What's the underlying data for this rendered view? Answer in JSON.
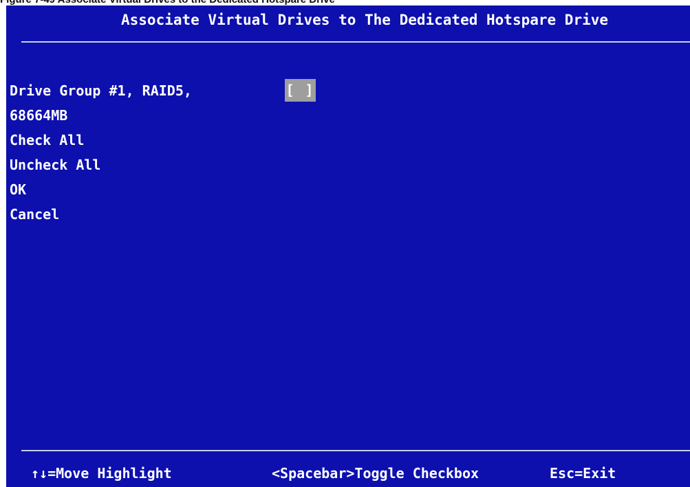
{
  "figure_caption": "Figure 7-49 Associate Virtual Drives to the Dedicated Hotspare Drive",
  "screen": {
    "title": "Associate Virtual Drives to The Dedicated Hotspare Drive",
    "drive_group_label": "Drive Group #1, RAID5,",
    "drive_group_size": "68664MB",
    "checkbox_state": "[ ]",
    "menu": {
      "check_all": "Check All",
      "uncheck_all": "Uncheck All",
      "ok": "OK",
      "cancel": "Cancel"
    },
    "status_bar": {
      "move": "↑↓=Move Highlight",
      "toggle": "<Spacebar>Toggle Checkbox",
      "exit": "Esc=Exit"
    }
  },
  "colors": {
    "background": "#0d10ad",
    "text": "#ffffff",
    "highlight": "#9e9e9e",
    "rule": "#c9cfee"
  }
}
